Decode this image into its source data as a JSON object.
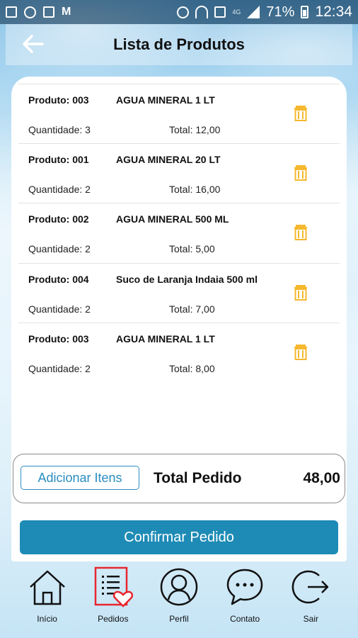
{
  "status_bar": {
    "network": "4G",
    "battery": "71%",
    "time": "12:34"
  },
  "header": {
    "title": "Lista de Produtos"
  },
  "items": [
    {
      "code": "Produto: 003",
      "name": "AGUA MINERAL 1 LT",
      "quantity": "Quantidade: 3",
      "total": "Total: 12,00"
    },
    {
      "code": "Produto: 001",
      "name": "AGUA MINERAL 20 LT",
      "quantity": "Quantidade: 2",
      "total": "Total: 16,00"
    },
    {
      "code": "Produto: 002",
      "name": "AGUA MINERAL 500 ML",
      "quantity": "Quantidade: 2",
      "total": "Total: 5,00"
    },
    {
      "code": "Produto: 004",
      "name": "Suco de Laranja Indaia 500 ml",
      "quantity": "Quantidade: 2",
      "total": "Total: 7,00"
    },
    {
      "code": "Produto: 003",
      "name": "AGUA MINERAL 1 LT",
      "quantity": "Quantidade: 2",
      "total": "Total: 8,00"
    }
  ],
  "summary": {
    "add_label": "Adicionar Itens",
    "total_label": "Total Pedido",
    "total_value": "48,00"
  },
  "confirm_label": "Confirmar Pedido",
  "nav": [
    {
      "label": "Início",
      "icon": "home-icon"
    },
    {
      "label": "Pedidos",
      "icon": "orders-icon"
    },
    {
      "label": "Perfil",
      "icon": "profile-icon"
    },
    {
      "label": "Contato",
      "icon": "chat-icon"
    },
    {
      "label": "Sair",
      "icon": "logout-icon"
    }
  ],
  "colors": {
    "accent": "#1e8bb6",
    "trash": "#f5b82e",
    "orders_highlight": "#e8262f"
  }
}
